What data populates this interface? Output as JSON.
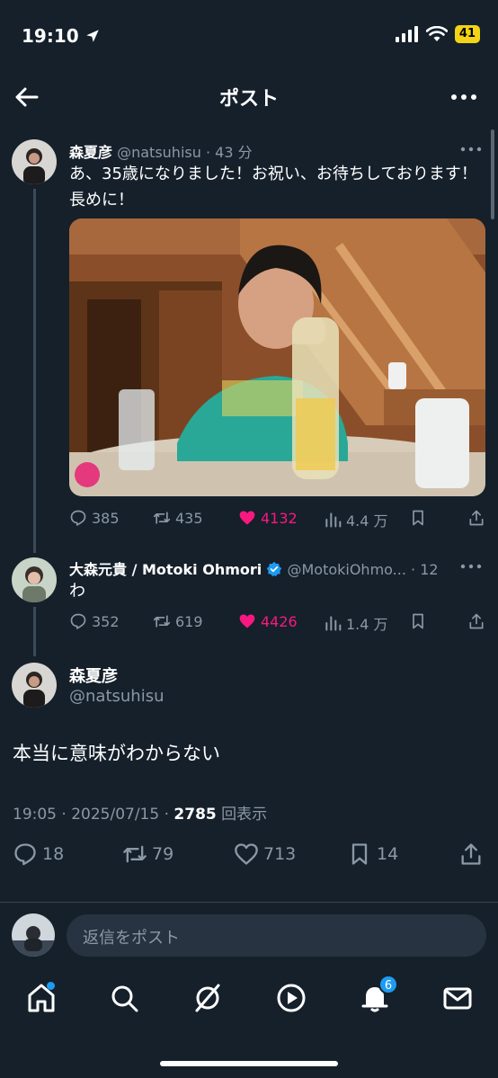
{
  "status_bar": {
    "time": "19:10",
    "battery": "41"
  },
  "header": {
    "title": "ポスト"
  },
  "tweet1": {
    "name": "森夏彦",
    "handle": "@natsuhisu",
    "time": "· 43 分",
    "text": "あ、35歳になりました！お祝い、お待ちしております！長めに！",
    "replies": "385",
    "retweets": "435",
    "likes": "4132",
    "views": "4.4 万"
  },
  "tweet2": {
    "name": "大森元貴 / Motoki Ohmori",
    "handle": "@MotokiOhmo...",
    "time": "· 12 分",
    "text": "わ",
    "replies": "352",
    "retweets": "619",
    "likes": "4426",
    "views": "1.4 万"
  },
  "main_tweet": {
    "name": "森夏彦",
    "handle": "@natsuhisu",
    "text": "本当に意味がわからない",
    "timestamp": "19:05 · 2025/07/15 · ",
    "view_count": "2785",
    "view_label": " 回表示",
    "replies": "18",
    "retweets": "79",
    "likes": "713",
    "bookmarks": "14"
  },
  "reply_bar": {
    "placeholder": "返信をポスト"
  },
  "tab_bar": {
    "notifications_badge": "6"
  },
  "colors": {
    "background": "#15202b",
    "accent": "#1d9bf0",
    "like": "#f91880",
    "muted": "#8b98a5"
  }
}
